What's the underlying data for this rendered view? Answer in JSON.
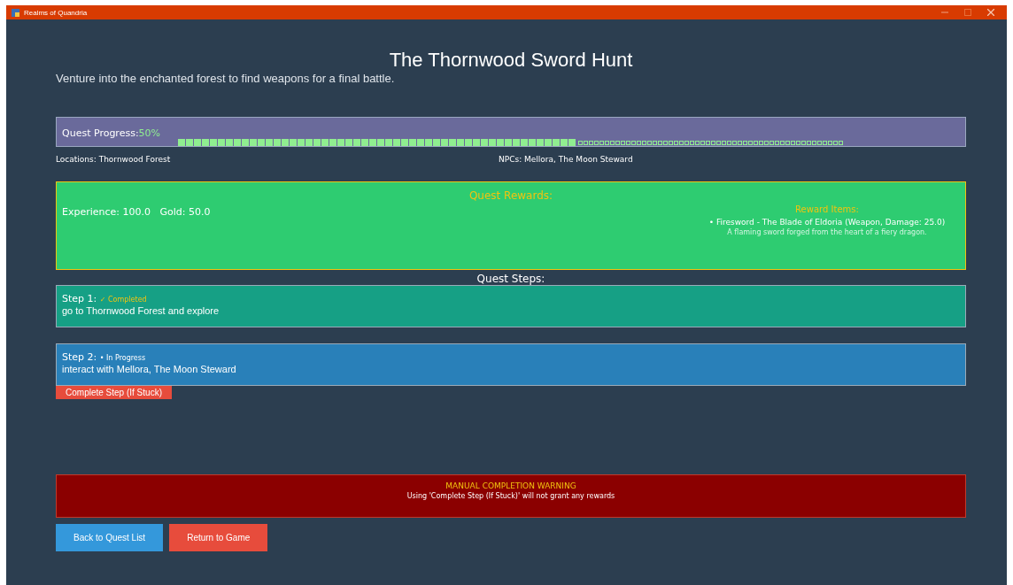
{
  "window": {
    "title": "Realms of Quandria"
  },
  "quest": {
    "title": "The Thornwood Sword Hunt",
    "description": "Venture into the enchanted forest to find weapons for a final battle."
  },
  "progress": {
    "label": "Quest Progress:",
    "value": "50%",
    "level": 0.5
  },
  "locations": "Locations: Thornwood Forest",
  "npcs": "NPCs: Mellora, The Moon Steward",
  "rewards": {
    "title": "Quest Rewards:",
    "stats": "Experience: 100.0   Gold: 50.0",
    "items_title": "Reward Items:",
    "items": [
      {
        "name": "• Firesword - The Blade of Eldoria (Weapon, Damage: 25.0)",
        "description": "A flaming sword forged from the heart of a fiery dragon."
      }
    ]
  },
  "steps_title": "Quest Steps:",
  "steps": [
    {
      "kind": "completed",
      "label": "Step 1:",
      "status": "✓ Completed",
      "text": "go to Thornwood Forest and explore"
    },
    {
      "kind": "in_progress",
      "label": "Step 2:",
      "status": "• In Progress",
      "text": "interact with Mellora, The Moon Steward",
      "action": "Complete Step (If Stuck)"
    }
  ],
  "warning": {
    "title": "MANUAL COMPLETION WARNING",
    "text": "Using 'Complete Step (If Stuck)' will not grant any rewards"
  },
  "buttons": [
    {
      "kind": "primary",
      "label": "Back to Quest List"
    },
    {
      "kind": "danger",
      "label": "Return to Game"
    }
  ]
}
